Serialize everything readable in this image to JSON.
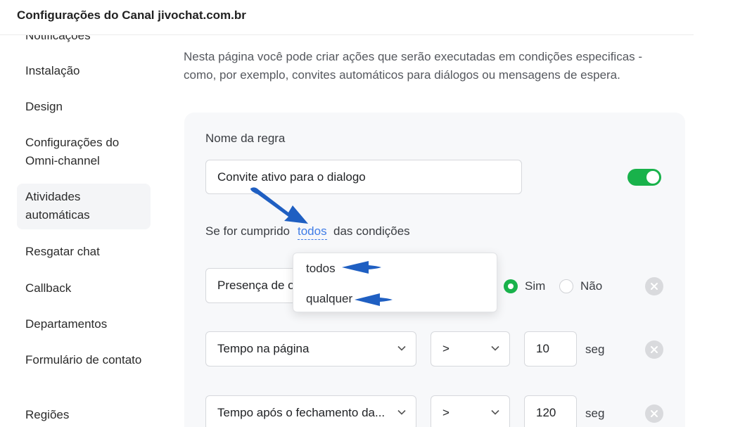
{
  "header": {
    "title": "Configurações do Canal jivochat.com.br"
  },
  "sidebar": {
    "items": [
      {
        "label": "Notificações"
      },
      {
        "label": "Instalação"
      },
      {
        "label": "Design"
      },
      {
        "label": "Configurações do Omni-channel"
      },
      {
        "label": "Atividades automáticas"
      },
      {
        "label": "Resgatar chat"
      },
      {
        "label": "Callback"
      },
      {
        "label": "Departamentos"
      },
      {
        "label": "Formulário de contato"
      },
      {
        "label": "Regiões"
      }
    ],
    "active": "Atividades automáticas"
  },
  "main": {
    "description": "Nesta página você pode criar ações que serão executadas em condições especificas - como, por exemplo, convites automáticos para diálogos ou mensagens de espera.",
    "rule": {
      "name_label": "Nome da regra",
      "name_value": "Convite ativo para o dialogo",
      "enabled": true,
      "condition_prefix": "Se for cumprido",
      "condition_mode": "todos",
      "condition_suffix": "das condições",
      "dropdown_options": [
        "todos",
        "qualquer"
      ],
      "conditions": [
        {
          "field": "Presença de o",
          "option_yes": "Sim",
          "option_no": "Não",
          "selected": "Sim"
        },
        {
          "field": "Tempo na página",
          "operator": ">",
          "value": "10",
          "unit": "seg"
        },
        {
          "field": "Tempo após o fechamento da...",
          "operator": ">",
          "value": "120",
          "unit": "seg"
        }
      ]
    }
  },
  "colors": {
    "accent_green": "#19b24b",
    "link_blue": "#3f7ce6",
    "annotation_arrow": "#1f5fc2"
  },
  "icons": [
    "chevron-down-icon",
    "close-icon",
    "arrow-annotation-icon"
  ]
}
